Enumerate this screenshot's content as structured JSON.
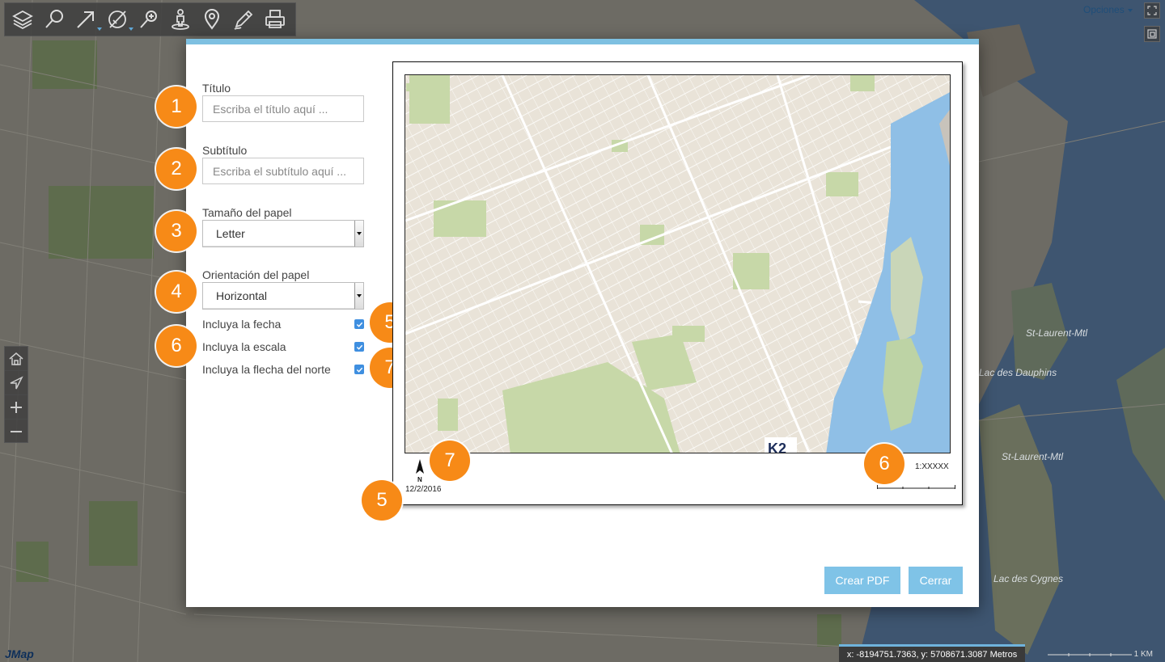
{
  "header": {
    "options_label": "Opciones"
  },
  "toolbar": {
    "tools": [
      {
        "icon": "layers-icon"
      },
      {
        "icon": "search-icon"
      },
      {
        "icon": "arrow-icon"
      },
      {
        "icon": "measure-icon"
      },
      {
        "icon": "zoom-pin-icon"
      },
      {
        "icon": "street-view-icon"
      },
      {
        "icon": "location-pin-icon"
      },
      {
        "icon": "edit-pencil-icon"
      },
      {
        "icon": "print-icon"
      }
    ]
  },
  "print_dialog": {
    "title_label": "Título",
    "title_placeholder": "Escriba el título aquí ...",
    "subtitle_label": "Subtítulo",
    "subtitle_placeholder": "Escriba el subtítulo aquí ...",
    "paper_size_label": "Tamaño del papel",
    "paper_size_value": "Letter",
    "orientation_label": "Orientación del papel",
    "orientation_value": "Horizontal",
    "include_date_label": "Incluya la fecha",
    "include_date_checked": true,
    "include_scale_label": "Incluya la escala",
    "include_scale_checked": true,
    "include_north_label": "Incluya la flecha del norte",
    "include_north_checked": true,
    "create_pdf_label": "Crear PDF",
    "close_label": "Cerrar",
    "badges": {
      "title": "1",
      "subtitle": "2",
      "paper_size": "3",
      "orientation": "4",
      "date": "5",
      "scale": "6",
      "north": "7",
      "preview_north": "7",
      "preview_scale": "6",
      "preview_date": "5"
    },
    "preview": {
      "scale_text": "1:XXXXX",
      "date_text": "12/2/2016",
      "north_letter": "N",
      "watermark": "K2"
    }
  },
  "map": {
    "labels": [
      "St-Laurent-Mtl",
      "Lac des Dauphins",
      "St-Laurent-Mtl",
      "Lac des Cygnes"
    ]
  },
  "status": {
    "coordinates": "x: -8194751.7363, y: 5708671.3087 Metros",
    "scale_unit": "1 KM",
    "logo": "JMap"
  },
  "colors": {
    "accent": "#7ec0e1",
    "badge": "#f78a17",
    "button": "#7fc3e7",
    "checkbox": "#3f8fe0"
  }
}
